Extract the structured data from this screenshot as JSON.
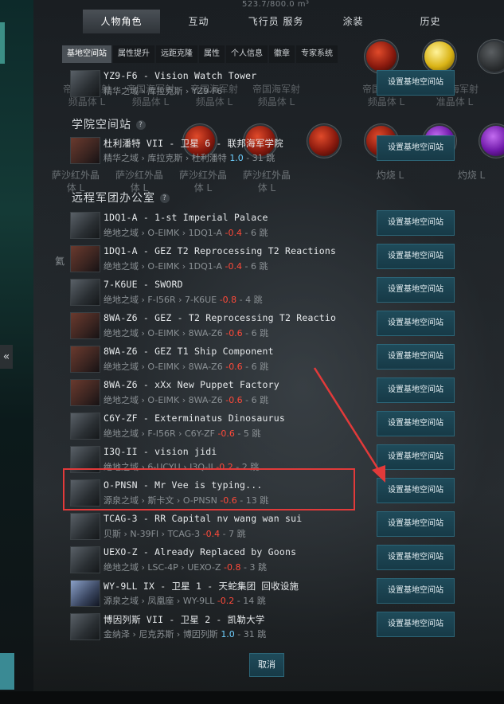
{
  "top_caption": "523.7/800.0 m³",
  "tabs": [
    "人物角色",
    "互动",
    "飞行员 服务",
    "涂装",
    "历史"
  ],
  "subtabs": [
    "基地空间站",
    "属性提升",
    "远距克隆",
    "属性",
    "个人信息",
    "徽章",
    "专家系统"
  ],
  "implant_row1": {
    "labels": [
      "帝国海军射\n频晶体 L",
      "帝国海军射\n频晶体 L",
      "帝国海军射\n频晶体 L",
      "帝国海军射\n频晶体 L",
      "帝国海军射\n频晶体 L",
      "帝国海军射\n准晶体 L"
    ]
  },
  "implant_row2": {
    "labels": [
      "萨沙红外晶\n体 L",
      "萨沙红外晶\n体 L",
      "萨沙红外晶\n体 L",
      "萨沙红外晶\n体 L",
      "灼烧 L",
      "灼烧 L"
    ]
  },
  "first_station": {
    "title": "YZ9-F6 - Vision Watch Tower",
    "path_prefix": "精华之域",
    "path_mid": "库拉克斯",
    "path_system": "YZ9-F6",
    "sec": "",
    "jumps": ""
  },
  "academy_section": {
    "title": "学院空间站",
    "help": "?"
  },
  "academy_station": {
    "title": "杜利潘特 VII - 卫星 6 - 联邦海军学院",
    "region": "精华之域",
    "constellation": "库拉克斯",
    "system": "杜利潘特",
    "sec": "1.0",
    "jumps": "31 跳",
    "button": "设置基地空间站"
  },
  "remote_section": {
    "title": "远程军团办公室",
    "help": "?"
  },
  "stations": [
    {
      "title": "1DQ1-A - 1-st Imperial Palace",
      "region": "绝地之域",
      "constellation": "O-EIMK",
      "system": "1DQ1-A",
      "sec": "-0.4",
      "jumps": "6 跳",
      "button": "设置基地空间站"
    },
    {
      "title": "1DQ1-A - GEZ T2 Reprocessing T2 Reactions",
      "region": "绝地之域",
      "constellation": "O-EIMK",
      "system": "1DQ1-A",
      "sec": "-0.4",
      "jumps": "6 跳",
      "button": "设置基地空间站"
    },
    {
      "title": "7-K6UE - SWORD",
      "region": "绝地之域",
      "constellation": "F-I56R",
      "system": "7-K6UE",
      "sec": "-0.8",
      "jumps": "4 跳",
      "button": "设置基地空间站"
    },
    {
      "title": "8WA-Z6 - GEZ - T2 Reprocessing T2 Reactio",
      "region": "绝地之域",
      "constellation": "O-EIMK",
      "system": "8WA-Z6",
      "sec": "-0.6",
      "jumps": "6 跳",
      "button": "设置基地空间站"
    },
    {
      "title": "8WA-Z6 - GEZ T1 Ship Component",
      "region": "绝地之域",
      "constellation": "O-EIMK",
      "system": "8WA-Z6",
      "sec": "-0.6",
      "jumps": "6 跳",
      "button": "设置基地空间站"
    },
    {
      "title": "8WA-Z6 - xXx New Puppet Factory",
      "region": "绝地之域",
      "constellation": "O-EIMK",
      "system": "8WA-Z6",
      "sec": "-0.6",
      "jumps": "6 跳",
      "button": "设置基地空间站"
    },
    {
      "title": "C6Y-ZF - Exterminatus Dinosaurus",
      "region": "绝地之域",
      "constellation": "F-I56R",
      "system": "C6Y-ZF",
      "sec": "-0.6",
      "jumps": "5 跳",
      "button": "设置基地空间站"
    },
    {
      "title": "I3Q-II - vision jidi",
      "region": "绝地之域",
      "constellation": "6-UCYU",
      "system": "I3Q-II",
      "sec": "-0.2",
      "jumps": "2 跳",
      "button": "设置基地空间站"
    },
    {
      "title": "O-PNSN - Mr Vee is typing...",
      "region": "源泉之域",
      "constellation": "斯卡文",
      "system": "O-PNSN",
      "sec": "-0.6",
      "jumps": "13 跳",
      "button": "设置基地空间站"
    },
    {
      "title": "TCAG-3 - RR Capital nv wang wan sui",
      "region": "贝斯",
      "constellation": "N-39FI",
      "system": "TCAG-3",
      "sec": "-0.4",
      "jumps": "7 跳",
      "button": "设置基地空间站"
    },
    {
      "title": "UEXO-Z - Already Replaced by Goons",
      "region": "绝地之域",
      "constellation": "LSC-4P",
      "system": "UEXO-Z",
      "sec": "-0.8",
      "jumps": "3 跳",
      "button": "设置基地空间站"
    },
    {
      "title": "WY-9LL IX - 卫星 1 - 天蛇集团 回收设施",
      "region": "源泉之域",
      "constellation": "凤凰座",
      "system": "WY-9LL",
      "sec": "-0.2",
      "jumps": "14 跳",
      "button": "设置基地空间站"
    },
    {
      "title": "博因列斯 VII - 卫星 2 - 凯勒大学",
      "region": "金纳泽",
      "constellation": "尼克苏斯",
      "system": "博因列斯",
      "sec": "1.0",
      "jumps": "31 跳",
      "button": "设置基地空间站"
    }
  ],
  "first_button": "设置基地空间站",
  "cancel_button": "取消",
  "left_chevron": "«",
  "side_label": "氦",
  "annotation_colors": {
    "highlight": "#e23a3a"
  }
}
